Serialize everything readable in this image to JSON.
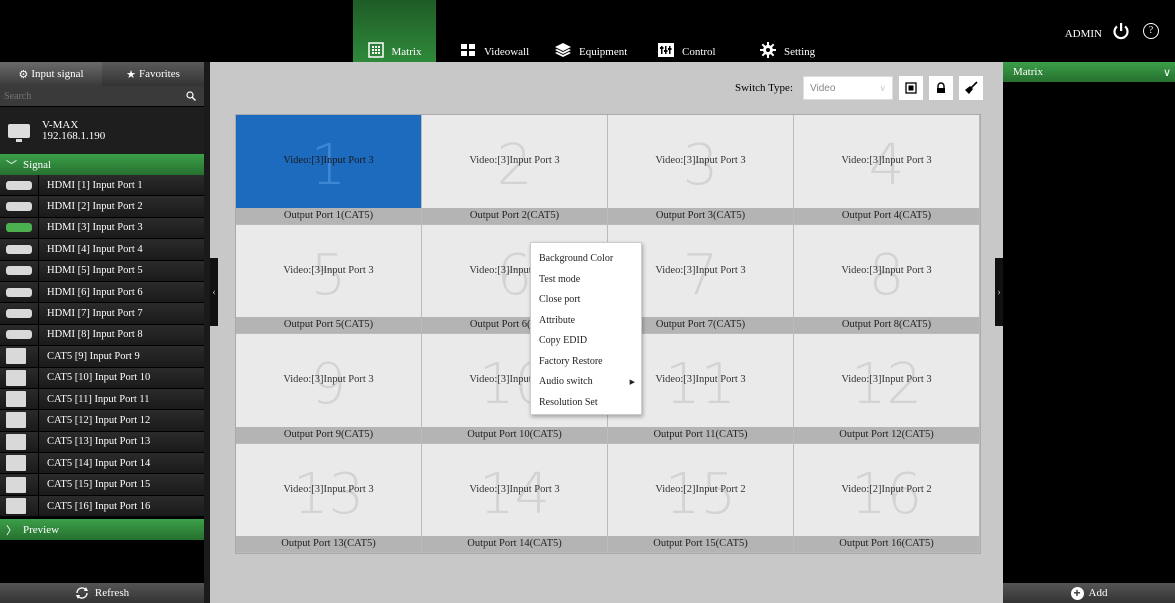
{
  "nav": {
    "matrix": "Matrix",
    "videowall": "Videowall",
    "equipment": "Equipment",
    "control": "Control",
    "setting": "Setting",
    "user": "ADMIN",
    "help": "?"
  },
  "left": {
    "tabs": {
      "input_signal": "Input signal",
      "favorites": "Favorites"
    },
    "search_placeholder": "Search",
    "device": {
      "name": "V-MAX",
      "ip": "192.168.1.190"
    },
    "signal_head": "Signal",
    "signals": [
      "HDMI [1] Input Port 1",
      "HDMI [2] Input Port 2",
      "HDMI [3] Input Port 3",
      "HDMI [4] Input Port 4",
      "HDMI [5] Input Port 5",
      "HDMI [6] Input Port 6",
      "HDMI [7] Input Port 7",
      "HDMI [8] Input Port 8",
      "CAT5 [9] Input Port 9",
      "CAT5 [10] Input Port 10",
      "CAT5 [11] Input Port 11",
      "CAT5 [12] Input Port 12",
      "CAT5 [13] Input Port 13",
      "CAT5 [14] Input Port 14",
      "CAT5 [15] Input Port 15",
      "CAT5 [16] Input Port 16"
    ],
    "preview_head": "Preview",
    "refresh": "Refresh"
  },
  "center": {
    "switch_type_label": "Switch Type:",
    "switch_type_value": "Video",
    "cells": [
      {
        "num": "1",
        "video": "Video:[3]Input Port 3",
        "output": "Output Port 1(CAT5)"
      },
      {
        "num": "2",
        "video": "Video:[3]Input Port 3",
        "output": "Output Port 2(CAT5)"
      },
      {
        "num": "3",
        "video": "Video:[3]Input Port 3",
        "output": "Output Port 3(CAT5)"
      },
      {
        "num": "4",
        "video": "Video:[3]Input Port 3",
        "output": "Output Port 4(CAT5)"
      },
      {
        "num": "5",
        "video": "Video:[3]Input Port 3",
        "output": "Output Port 5(CAT5)"
      },
      {
        "num": "6",
        "video": "Video:[3]Input Port 3",
        "output": "Output Port 6(CAT5)"
      },
      {
        "num": "7",
        "video": "Video:[3]Input Port 3",
        "output": "Output Port 7(CAT5)"
      },
      {
        "num": "8",
        "video": "Video:[3]Input Port 3",
        "output": "Output Port 8(CAT5)"
      },
      {
        "num": "9",
        "video": "Video:[3]Input Port 3",
        "output": "Output Port 9(CAT5)"
      },
      {
        "num": "10",
        "video": "Video:[3]Input Port 3",
        "output": "Output Port 10(CAT5)"
      },
      {
        "num": "11",
        "video": "Video:[3]Input Port 3",
        "output": "Output Port 11(CAT5)"
      },
      {
        "num": "12",
        "video": "Video:[3]Input Port 3",
        "output": "Output Port 12(CAT5)"
      },
      {
        "num": "13",
        "video": "Video:[3]Input Port 3",
        "output": "Output Port 13(CAT5)"
      },
      {
        "num": "14",
        "video": "Video:[3]Input Port 3",
        "output": "Output Port 14(CAT5)"
      },
      {
        "num": "15",
        "video": "Video:[2]Input Port 2",
        "output": "Output Port 15(CAT5)"
      },
      {
        "num": "16",
        "video": "Video:[2]Input Port 2",
        "output": "Output Port 16(CAT5)"
      }
    ],
    "context_menu": [
      "Background Color",
      "Test mode",
      "Close port",
      "Attribute",
      "Copy EDID",
      "Factory Restore",
      "Audio switch",
      "Resolution Set"
    ]
  },
  "right": {
    "head": "Matrix",
    "add": "Add"
  },
  "colors": {
    "accent_green": "#2f8a3a",
    "selected_blue": "#1d6bbf",
    "active_signal": "#4caf50"
  }
}
